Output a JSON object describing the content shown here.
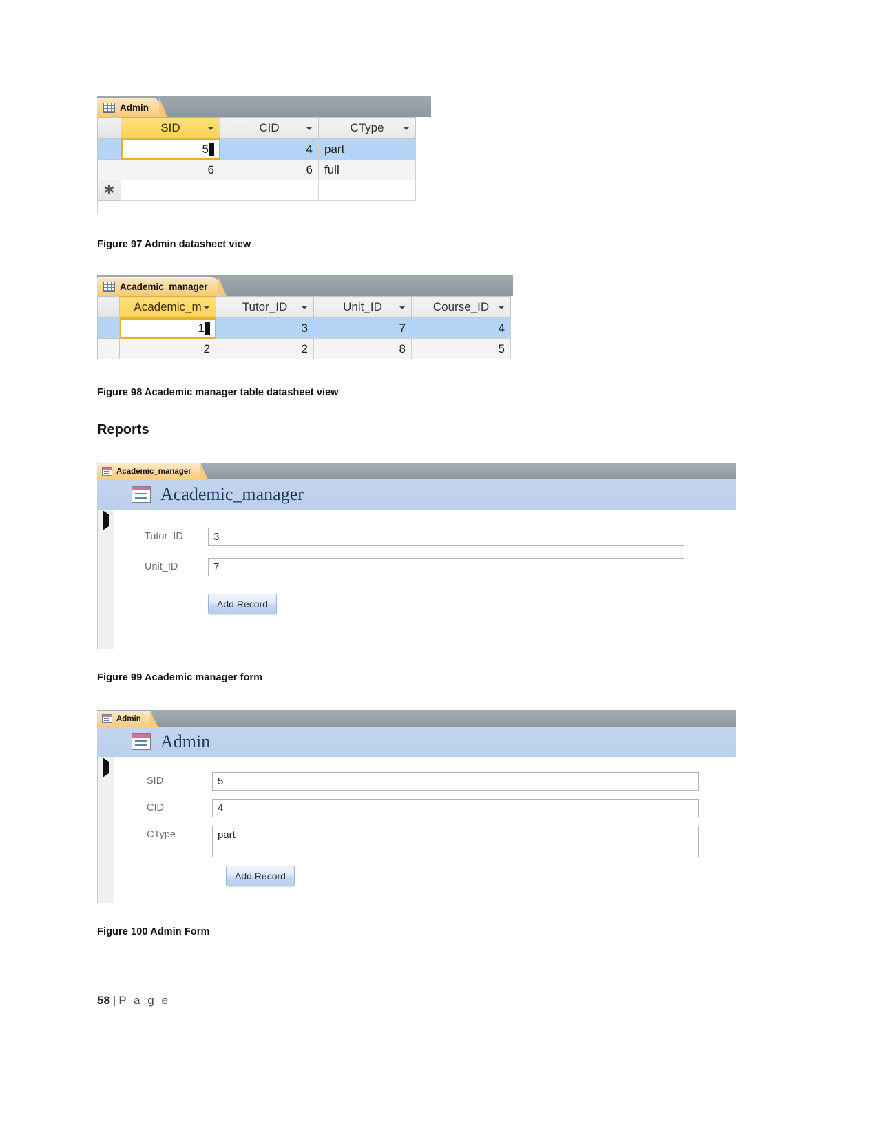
{
  "page": {
    "number": "58",
    "separator": "|",
    "word": "P a g e"
  },
  "figures": {
    "fig97_caption": "Figure 97 Admin datasheet view",
    "fig98_caption": "Figure 98 Academic manager table datasheet view",
    "fig99_caption": "Figure 99 Academic manager form",
    "fig100_caption": "Figure 100 Admin Form"
  },
  "headings": {
    "reports": "Reports"
  },
  "admin_datasheet": {
    "tab_label": "Admin",
    "tab_icon": "table-grid-icon",
    "columns": [
      "SID",
      "CID",
      "CType"
    ],
    "selected_column": "SID",
    "rows": [
      {
        "SID": "5",
        "CID": "4",
        "CType": "part",
        "selected": true,
        "editing_cell": "SID"
      },
      {
        "SID": "6",
        "CID": "6",
        "CType": "full",
        "selected": false,
        "editing_cell": ""
      },
      {
        "SID": "",
        "CID": "",
        "CType": "",
        "selected": false,
        "editing_cell": "",
        "new_record": true
      }
    ],
    "new_record_marker": "✱"
  },
  "academic_manager_datasheet": {
    "tab_label": "Academic_manager",
    "tab_icon": "table-grid-icon",
    "columns": [
      "Academic_m",
      "Tutor_ID",
      "Unit_ID",
      "Course_ID"
    ],
    "selected_column": "Academic_m",
    "rows": [
      {
        "Academic_m": "1",
        "Tutor_ID": "3",
        "Unit_ID": "7",
        "Course_ID": "4",
        "selected": true,
        "editing_cell": "Academic_m"
      },
      {
        "Academic_m": "2",
        "Tutor_ID": "2",
        "Unit_ID": "8",
        "Course_ID": "5",
        "selected": false,
        "editing_cell": ""
      }
    ]
  },
  "academic_manager_form": {
    "tab_label": "Academic_manager",
    "tab_icon": "form-view-icon",
    "header_title": "Academic_manager",
    "header_icon": "form-view-icon",
    "record_selector_icon": "record-arrow-icon",
    "fields": [
      {
        "label": "Tutor_ID",
        "value": "3"
      },
      {
        "label": "Unit_ID",
        "value": "7"
      }
    ],
    "add_button_label": "Add Record"
  },
  "admin_form": {
    "tab_label": "Admin",
    "tab_icon": "form-view-icon",
    "header_title": "Admin",
    "header_icon": "form-view-icon",
    "record_selector_icon": "record-arrow-icon",
    "fields": [
      {
        "label": "SID",
        "value": "5"
      },
      {
        "label": "CID",
        "value": "4"
      },
      {
        "label": "CType",
        "value": "part"
      }
    ],
    "add_button_label": "Add Record"
  },
  "colors": {
    "tab_orange": "#f8c877",
    "tab_bar_gray": "#97a0a7",
    "header_gold": "#fcd257",
    "row_selected_blue": "#b4d5f5",
    "form_header_blue": "#bacfea",
    "form_title_navy": "#1f3864"
  }
}
